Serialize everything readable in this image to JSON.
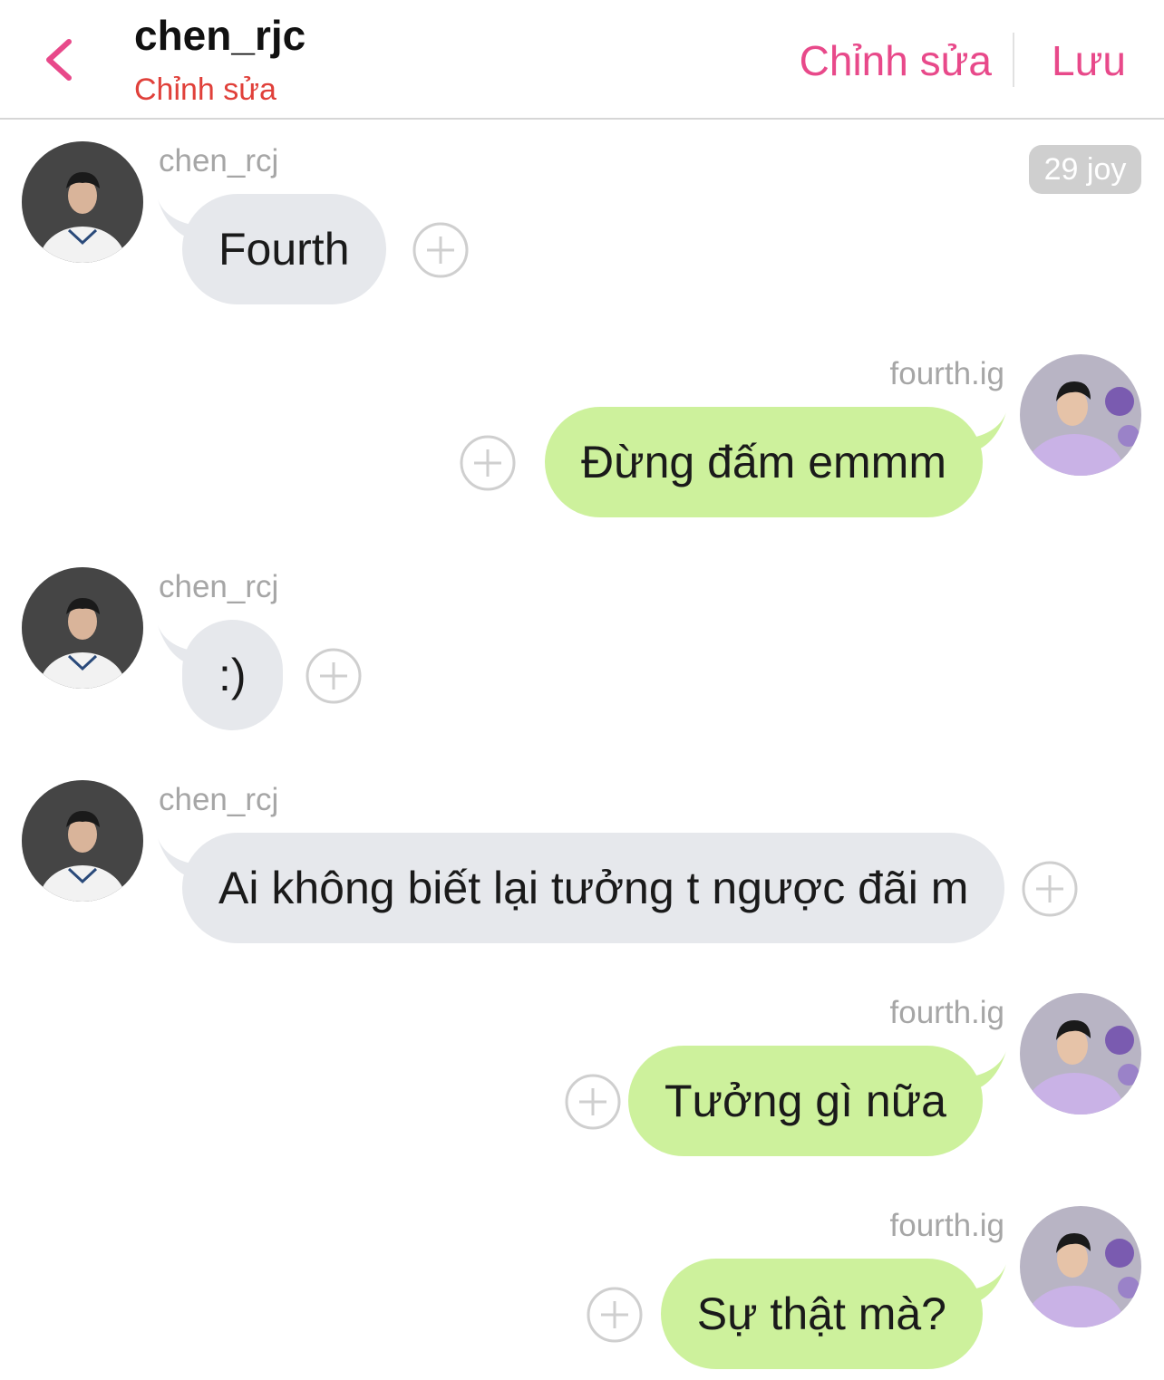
{
  "header": {
    "title": "chen_rjc",
    "subtitle": "Chỉnh sửa",
    "edit_label": "Chỉnh sửa",
    "save_label": "Lưu"
  },
  "time_badge": "29 joy",
  "colors": {
    "accent": "#e8498a",
    "subtitle": "#e0403a",
    "incoming_bubble": "#e6e8ec",
    "outgoing_bubble": "#cdf19c"
  },
  "icons": {
    "back": "chevron-left-icon",
    "add_reaction": "plus-circle-icon"
  },
  "messages": [
    {
      "sender": "chen_rcj",
      "text": "Fourth",
      "side": "in"
    },
    {
      "sender": "fourth.ig",
      "text": "Đừng đấm emmm",
      "side": "out"
    },
    {
      "sender": "chen_rcj",
      "text": ":)",
      "side": "in"
    },
    {
      "sender": "chen_rcj",
      "text": "Ai không biết lại tưởng t ngược đãi m",
      "side": "in"
    },
    {
      "sender": "fourth.ig",
      "text": "Tưởng gì nữa",
      "side": "out"
    },
    {
      "sender": "fourth.ig",
      "text": "Sự thật mà?",
      "side": "out"
    }
  ]
}
